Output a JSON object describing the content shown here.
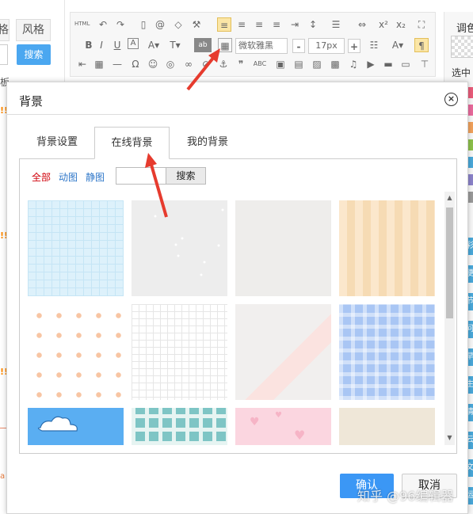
{
  "editor": {
    "style_button": "风格",
    "search_button": "搜索",
    "left_cut_char_1": "板",
    "left_cut_char_2": "板",
    "hot_badge": "!!",
    "toolbar": {
      "html_label": "HTML",
      "font_family": "微软雅黑",
      "font_size": "17px",
      "minus": "-",
      "plus": "+",
      "abc": "ABC"
    },
    "right_panel": {
      "top_label": "调色",
      "select_label": "选中",
      "swatches": [
        "#e85b7a",
        "#e86a9c",
        "#f0a15c",
        "#8cc04a",
        "#49a7d8",
        "#8a82c9",
        "#999999"
      ],
      "tabs": [
        "彩",
        "便",
        "节",
        "问",
        "早",
        "生",
        "清",
        "云",
        "文",
        "运"
      ]
    }
  },
  "modal": {
    "title": "背景",
    "close": "×",
    "tabs": [
      "背景设置",
      "在线背景",
      "我的背景"
    ],
    "active_tab": "在线背景",
    "filters": [
      "全部",
      "动图",
      "静图"
    ],
    "active_filter": "全部",
    "search_value": "",
    "search_button": "搜索",
    "confirm_button": "确认",
    "cancel_button": "取消",
    "scroll_up": "▲",
    "scroll_down": "▼"
  },
  "watermark": "知乎 @96编辑器",
  "colors": {
    "accent_blue": "#3b97f5",
    "annotation_red": "#e63b2e",
    "active_filter_red": "#d0000a",
    "link_blue": "#2f77c9"
  }
}
